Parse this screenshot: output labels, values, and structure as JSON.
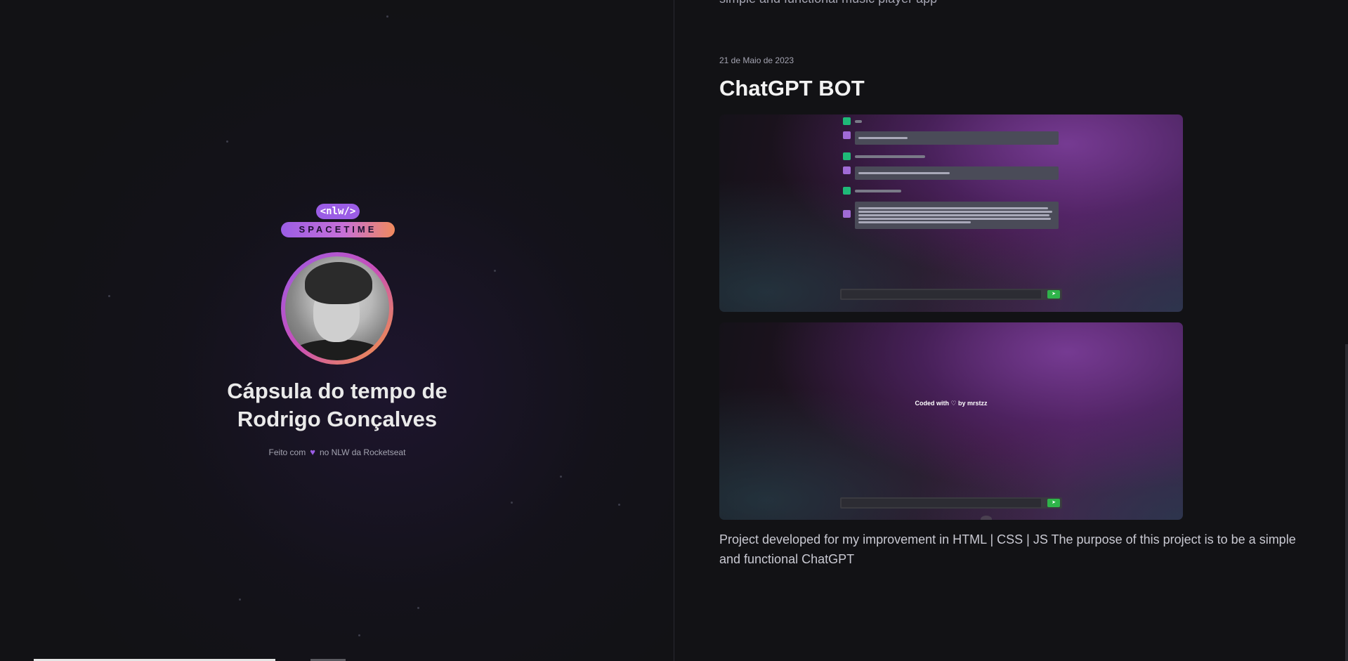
{
  "brand": {
    "logo_tag": "<nlw/>",
    "logo_word": "SPACETIME"
  },
  "profile": {
    "title_prefix": "Cápsula do tempo de",
    "name": "Rodrigo Gonçalves",
    "made_with_before": "Feito com",
    "made_with_after": "no NLW da Rocketseat"
  },
  "previous_memory": {
    "description_tail": "simple and functional music player app"
  },
  "memory": {
    "date": "21 de Maio de 2023",
    "title": "ChatGPT BOT",
    "screenshot_2_footer": "Coded with ♡ by mrstzz",
    "description": "Project developed for my improvement in HTML | CSS | JS The purpose of this project is to be a simple and functional ChatGPT"
  },
  "colors": {
    "background": "#121215",
    "accent_purple": "#9b5de5",
    "accent_orange": "#f59a3a",
    "text_muted": "#a3a3b0"
  },
  "icons": {
    "heart": "heart-icon",
    "send": "send-icon"
  }
}
